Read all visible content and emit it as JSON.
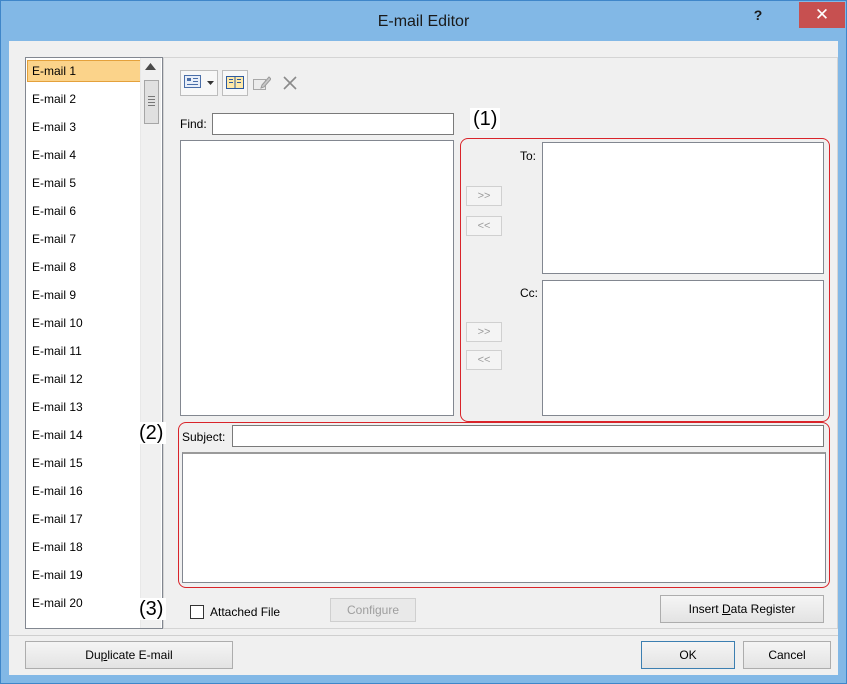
{
  "window": {
    "title": "E-mail Editor",
    "help_glyph": "?",
    "close_glyph": "✕"
  },
  "email_list": {
    "items": [
      "E-mail 1",
      "E-mail 2",
      "E-mail 3",
      "E-mail 4",
      "E-mail 5",
      "E-mail 6",
      "E-mail 7",
      "E-mail 8",
      "E-mail 9",
      "E-mail 10",
      "E-mail 11",
      "E-mail 12",
      "E-mail 13",
      "E-mail 14",
      "E-mail 15",
      "E-mail 16",
      "E-mail 17",
      "E-mail 18",
      "E-mail 19",
      "E-mail 20"
    ],
    "selected": "E-mail 1"
  },
  "toolbar": {
    "icons": [
      "address-book-view-icon",
      "dropdown-arrow-icon",
      "address-book-icon",
      "edit-contact-icon",
      "delete-icon"
    ]
  },
  "find": {
    "label": "Find:",
    "value": ""
  },
  "recipients": {
    "to_label": "To:",
    "cc_label": "Cc:",
    "add_label": ">>",
    "remove_label": "<<"
  },
  "subject": {
    "label": "Subject:",
    "value": ""
  },
  "body": {
    "value": ""
  },
  "attachment": {
    "label": "Attached File",
    "checked": false,
    "configure_label": "Configure"
  },
  "insert_register": {
    "prefix": "Insert ",
    "mnemonic": "D",
    "suffix": "ata Register"
  },
  "footer": {
    "duplicate_prefix": "Du",
    "duplicate_mnemonic": "p",
    "duplicate_suffix": "licate E-mail",
    "ok_label": "OK",
    "cancel_label": "Cancel"
  },
  "callouts": {
    "c1": "(1)",
    "c2": "(2)",
    "c3": "(3)"
  },
  "colors": {
    "title_bar": "#82b8e6",
    "close_button": "#c75050",
    "callout_border": "#d9242a",
    "selection": "#fbd38a"
  }
}
